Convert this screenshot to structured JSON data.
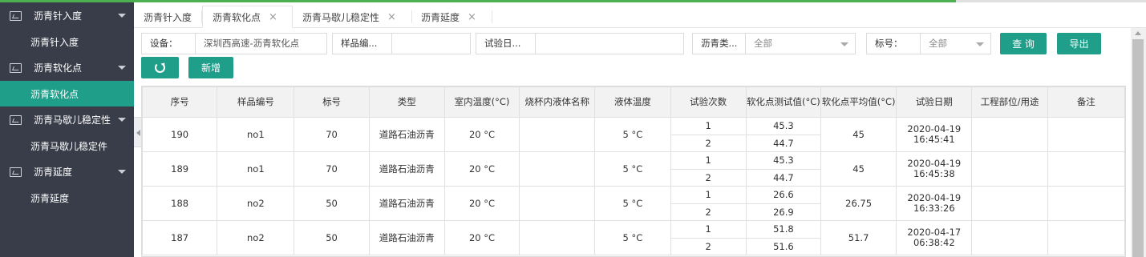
{
  "sidebar": {
    "groups": [
      {
        "label": "沥青针入度",
        "children": [
          "沥青针入度"
        ]
      },
      {
        "label": "沥青软化点",
        "children": [
          "沥青软化点"
        ]
      },
      {
        "label": "沥青马歇儿稳定性",
        "children": [
          "沥青马歇儿稳定件"
        ]
      },
      {
        "label": "沥青延度",
        "children": [
          "沥青延度"
        ]
      }
    ],
    "active_item": "沥青软化点"
  },
  "tabs": [
    {
      "label": "沥青针入度"
    },
    {
      "label": "沥青软化点"
    },
    {
      "label": "沥青马歇儿稳定性"
    },
    {
      "label": "沥青延度"
    }
  ],
  "close_glyph": "×",
  "filters": {
    "device_label": "设备：",
    "device_value": "深圳西高速-沥青软化点",
    "sample_label": "样品编...",
    "sample_value": "",
    "date_label": "试验日...",
    "date_value": "",
    "asphalt_label": "沥青类...",
    "asphalt_value": "全部",
    "grade_label": "标号：",
    "grade_value": "全部",
    "query_label": "查 询",
    "export_label": "导出",
    "add_label": "新增"
  },
  "table": {
    "headers": [
      "序号",
      "样品编号",
      "标号",
      "类型",
      "室内温度(°C)",
      "烧杯内液体名称",
      "液体温度",
      "试验次数",
      "软化点测试值(°C)",
      "软化点平均值(°C)",
      "试验日期",
      "工程部位/用途",
      "备注"
    ],
    "rows": [
      {
        "seq": "190",
        "sample": "no1",
        "grade": "70",
        "type": "道路石油沥青",
        "room_temp": "20 °C",
        "liquid": "",
        "liquid_temp": "5 °C",
        "trials": [
          "1",
          "2"
        ],
        "values": [
          "45.3",
          "44.7"
        ],
        "avg": "45",
        "date": "2020-04-19",
        "time": "16:45:41",
        "part": "",
        "note": ""
      },
      {
        "seq": "189",
        "sample": "no1",
        "grade": "70",
        "type": "道路石油沥青",
        "room_temp": "20 °C",
        "liquid": "",
        "liquid_temp": "5 °C",
        "trials": [
          "1",
          "2"
        ],
        "values": [
          "45.3",
          "44.7"
        ],
        "avg": "45",
        "date": "2020-04-19",
        "time": "16:45:38",
        "part": "",
        "note": ""
      },
      {
        "seq": "188",
        "sample": "no2",
        "grade": "50",
        "type": "道路石油沥青",
        "room_temp": "20 °C",
        "liquid": "",
        "liquid_temp": "5 °C",
        "trials": [
          "1",
          "2"
        ],
        "values": [
          "26.6",
          "26.9"
        ],
        "avg": "26.75",
        "date": "2020-04-19",
        "time": "16:33:26",
        "part": "",
        "note": ""
      },
      {
        "seq": "187",
        "sample": "no2",
        "grade": "50",
        "type": "道路石油沥青",
        "room_temp": "20 °C",
        "liquid": "",
        "liquid_temp": "5 °C",
        "trials": [
          "1",
          "2"
        ],
        "values": [
          "51.8",
          "51.6"
        ],
        "avg": "51.7",
        "date": "2020-04-17",
        "time": "06:38:42",
        "part": "",
        "note": ""
      }
    ]
  },
  "colors": {
    "accent": "#1f9e8a",
    "sidebar_bg": "#383d49",
    "top_line": "#4caf50"
  }
}
